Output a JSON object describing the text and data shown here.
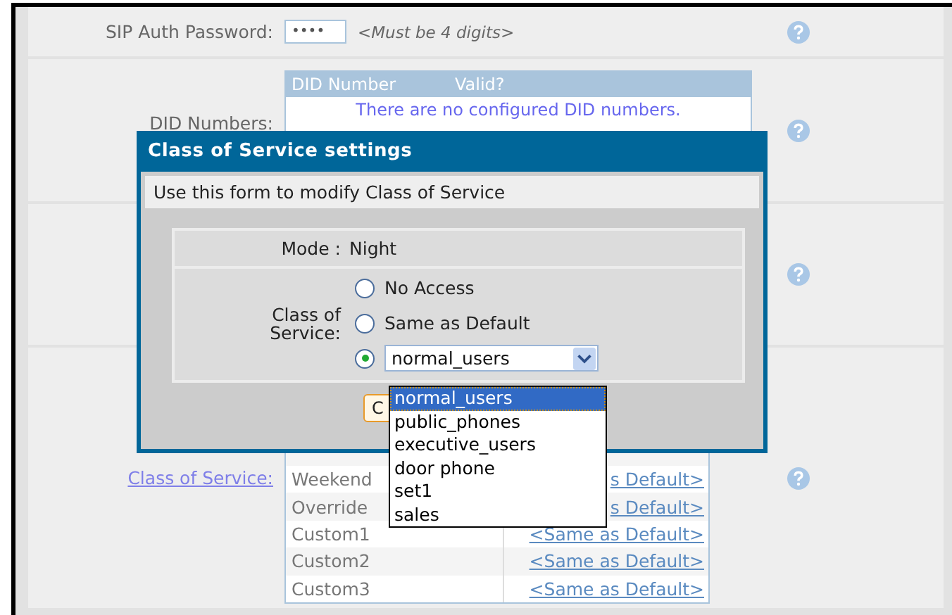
{
  "password": {
    "label": "SIP Auth Password:",
    "value": "••••",
    "hint": "<Must be 4 digits>"
  },
  "did": {
    "label": "DID Numbers:",
    "columns": [
      "DID Number",
      "Valid?"
    ],
    "empty_message": "There are no configured DID numbers."
  },
  "class_of_service": {
    "label": "Class of Service:",
    "rows": [
      {
        "name": "Weekend",
        "value": "s Default>"
      },
      {
        "name": "Override",
        "value": "s Default>"
      },
      {
        "name": "Custom1",
        "value": "<Same as Default>"
      },
      {
        "name": "Custom2",
        "value": "<Same as Default>"
      },
      {
        "name": "Custom3",
        "value": "<Same as Default>"
      }
    ]
  },
  "dialog": {
    "title": "Class of Service settings",
    "subtitle": "Use this form to modify Class of Service",
    "mode_label": "Mode :",
    "mode_value": "Night",
    "field_label": "Class of Service:",
    "options": [
      {
        "kind": "radio",
        "label": "No Access",
        "selected": false
      },
      {
        "kind": "radio",
        "label": "Same as Default",
        "selected": false
      },
      {
        "kind": "select",
        "value": "normal_users",
        "selected": true
      }
    ],
    "dropdown": [
      {
        "label": "normal_users",
        "selected": true
      },
      {
        "label": "public_phones",
        "selected": false
      },
      {
        "label": "executive_users",
        "selected": false
      },
      {
        "label": "door phone",
        "selected": false
      },
      {
        "label": "set1",
        "selected": false
      },
      {
        "label": "sales",
        "selected": false
      }
    ],
    "button": "C"
  }
}
